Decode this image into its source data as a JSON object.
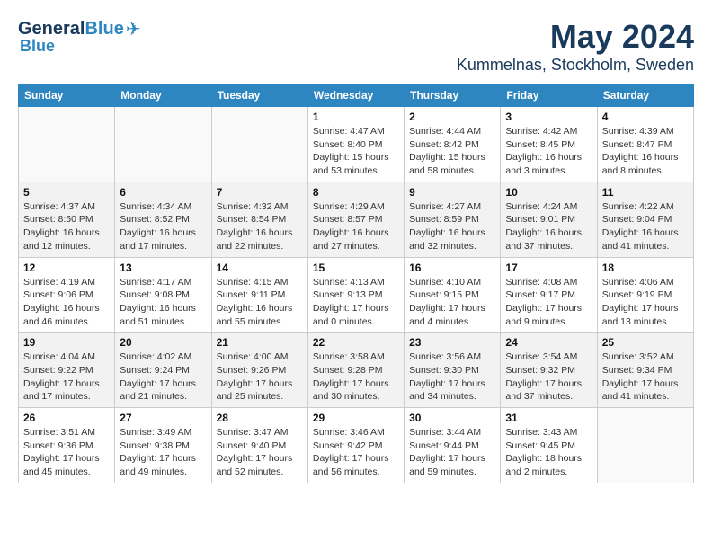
{
  "header": {
    "logo_line1": "General",
    "logo_line2": "Blue",
    "title": "May 2024",
    "subtitle": "Kummelnas, Stockholm, Sweden"
  },
  "weekdays": [
    "Sunday",
    "Monday",
    "Tuesday",
    "Wednesday",
    "Thursday",
    "Friday",
    "Saturday"
  ],
  "weeks": [
    [
      {
        "day": "",
        "detail": ""
      },
      {
        "day": "",
        "detail": ""
      },
      {
        "day": "",
        "detail": ""
      },
      {
        "day": "1",
        "detail": "Sunrise: 4:47 AM\nSunset: 8:40 PM\nDaylight: 15 hours\nand 53 minutes."
      },
      {
        "day": "2",
        "detail": "Sunrise: 4:44 AM\nSunset: 8:42 PM\nDaylight: 15 hours\nand 58 minutes."
      },
      {
        "day": "3",
        "detail": "Sunrise: 4:42 AM\nSunset: 8:45 PM\nDaylight: 16 hours\nand 3 minutes."
      },
      {
        "day": "4",
        "detail": "Sunrise: 4:39 AM\nSunset: 8:47 PM\nDaylight: 16 hours\nand 8 minutes."
      }
    ],
    [
      {
        "day": "5",
        "detail": "Sunrise: 4:37 AM\nSunset: 8:50 PM\nDaylight: 16 hours\nand 12 minutes."
      },
      {
        "day": "6",
        "detail": "Sunrise: 4:34 AM\nSunset: 8:52 PM\nDaylight: 16 hours\nand 17 minutes."
      },
      {
        "day": "7",
        "detail": "Sunrise: 4:32 AM\nSunset: 8:54 PM\nDaylight: 16 hours\nand 22 minutes."
      },
      {
        "day": "8",
        "detail": "Sunrise: 4:29 AM\nSunset: 8:57 PM\nDaylight: 16 hours\nand 27 minutes."
      },
      {
        "day": "9",
        "detail": "Sunrise: 4:27 AM\nSunset: 8:59 PM\nDaylight: 16 hours\nand 32 minutes."
      },
      {
        "day": "10",
        "detail": "Sunrise: 4:24 AM\nSunset: 9:01 PM\nDaylight: 16 hours\nand 37 minutes."
      },
      {
        "day": "11",
        "detail": "Sunrise: 4:22 AM\nSunset: 9:04 PM\nDaylight: 16 hours\nand 41 minutes."
      }
    ],
    [
      {
        "day": "12",
        "detail": "Sunrise: 4:19 AM\nSunset: 9:06 PM\nDaylight: 16 hours\nand 46 minutes."
      },
      {
        "day": "13",
        "detail": "Sunrise: 4:17 AM\nSunset: 9:08 PM\nDaylight: 16 hours\nand 51 minutes."
      },
      {
        "day": "14",
        "detail": "Sunrise: 4:15 AM\nSunset: 9:11 PM\nDaylight: 16 hours\nand 55 minutes."
      },
      {
        "day": "15",
        "detail": "Sunrise: 4:13 AM\nSunset: 9:13 PM\nDaylight: 17 hours\nand 0 minutes."
      },
      {
        "day": "16",
        "detail": "Sunrise: 4:10 AM\nSunset: 9:15 PM\nDaylight: 17 hours\nand 4 minutes."
      },
      {
        "day": "17",
        "detail": "Sunrise: 4:08 AM\nSunset: 9:17 PM\nDaylight: 17 hours\nand 9 minutes."
      },
      {
        "day": "18",
        "detail": "Sunrise: 4:06 AM\nSunset: 9:19 PM\nDaylight: 17 hours\nand 13 minutes."
      }
    ],
    [
      {
        "day": "19",
        "detail": "Sunrise: 4:04 AM\nSunset: 9:22 PM\nDaylight: 17 hours\nand 17 minutes."
      },
      {
        "day": "20",
        "detail": "Sunrise: 4:02 AM\nSunset: 9:24 PM\nDaylight: 17 hours\nand 21 minutes."
      },
      {
        "day": "21",
        "detail": "Sunrise: 4:00 AM\nSunset: 9:26 PM\nDaylight: 17 hours\nand 25 minutes."
      },
      {
        "day": "22",
        "detail": "Sunrise: 3:58 AM\nSunset: 9:28 PM\nDaylight: 17 hours\nand 30 minutes."
      },
      {
        "day": "23",
        "detail": "Sunrise: 3:56 AM\nSunset: 9:30 PM\nDaylight: 17 hours\nand 34 minutes."
      },
      {
        "day": "24",
        "detail": "Sunrise: 3:54 AM\nSunset: 9:32 PM\nDaylight: 17 hours\nand 37 minutes."
      },
      {
        "day": "25",
        "detail": "Sunrise: 3:52 AM\nSunset: 9:34 PM\nDaylight: 17 hours\nand 41 minutes."
      }
    ],
    [
      {
        "day": "26",
        "detail": "Sunrise: 3:51 AM\nSunset: 9:36 PM\nDaylight: 17 hours\nand 45 minutes."
      },
      {
        "day": "27",
        "detail": "Sunrise: 3:49 AM\nSunset: 9:38 PM\nDaylight: 17 hours\nand 49 minutes."
      },
      {
        "day": "28",
        "detail": "Sunrise: 3:47 AM\nSunset: 9:40 PM\nDaylight: 17 hours\nand 52 minutes."
      },
      {
        "day": "29",
        "detail": "Sunrise: 3:46 AM\nSunset: 9:42 PM\nDaylight: 17 hours\nand 56 minutes."
      },
      {
        "day": "30",
        "detail": "Sunrise: 3:44 AM\nSunset: 9:44 PM\nDaylight: 17 hours\nand 59 minutes."
      },
      {
        "day": "31",
        "detail": "Sunrise: 3:43 AM\nSunset: 9:45 PM\nDaylight: 18 hours\nand 2 minutes."
      },
      {
        "day": "",
        "detail": ""
      }
    ]
  ]
}
